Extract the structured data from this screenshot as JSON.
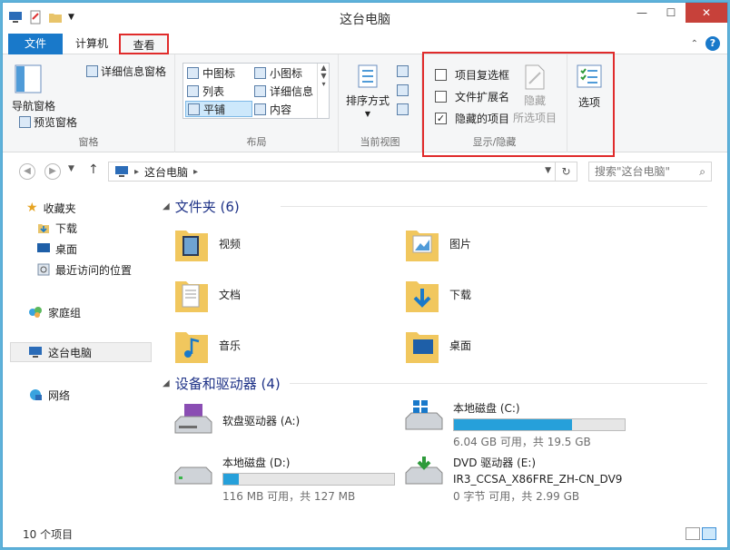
{
  "window": {
    "title": "这台电脑",
    "controls": {
      "minimize": "—",
      "maximize": "☐",
      "close": "✕"
    }
  },
  "tabs": {
    "file": "文件",
    "computer": "计算机",
    "view": "查看"
  },
  "help": "?",
  "ribbon": {
    "panes": {
      "nav_pane": "导航窗格",
      "preview_pane": "预览窗格",
      "details_pane": "详细信息窗格",
      "label": "窗格"
    },
    "layout": {
      "items": [
        "中图标",
        "小图标",
        "列表",
        "详细信息",
        "平铺",
        "内容"
      ],
      "selected": "平铺",
      "label": "布局"
    },
    "current_view": {
      "sort": "排序方式",
      "label": "当前视图"
    },
    "show_hide": {
      "item_checkboxes": "项目复选框",
      "file_extensions": "文件扩展名",
      "hidden_items": "隐藏的项目",
      "hide_selected_1": "隐藏",
      "hide_selected_2": "所选项目",
      "label": "显示/隐藏"
    },
    "options": "选项"
  },
  "address": {
    "path": "这台电脑",
    "search_placeholder": "搜索\"这台电脑\""
  },
  "nav": {
    "favorites": "收藏夹",
    "downloads": "下载",
    "desktop": "桌面",
    "recent": "最近访问的位置",
    "homegroup": "家庭组",
    "this_pc": "这台电脑",
    "network": "网络"
  },
  "content": {
    "folders_header": "文件夹 (6)",
    "folders": [
      "视频",
      "图片",
      "文档",
      "下载",
      "音乐",
      "桌面"
    ],
    "devices_header": "设备和驱动器 (4)",
    "drives": [
      {
        "name": "软盘驱动器 (A:)",
        "sub": "",
        "used": null
      },
      {
        "name": "本地磁盘 (C:)",
        "sub": "6.04 GB 可用，共 19.5 GB",
        "used": 0.69
      },
      {
        "name": "本地磁盘 (D:)",
        "sub": "116 MB 可用，共 127 MB",
        "used": 0.09
      },
      {
        "name": "DVD 驱动器 (E:)",
        "name2": "IR3_CCSA_X86FRE_ZH-CN_DV9",
        "sub": "0 字节 可用，共 2.99 GB",
        "used": null
      }
    ]
  },
  "status": {
    "count": "10 个项目"
  }
}
